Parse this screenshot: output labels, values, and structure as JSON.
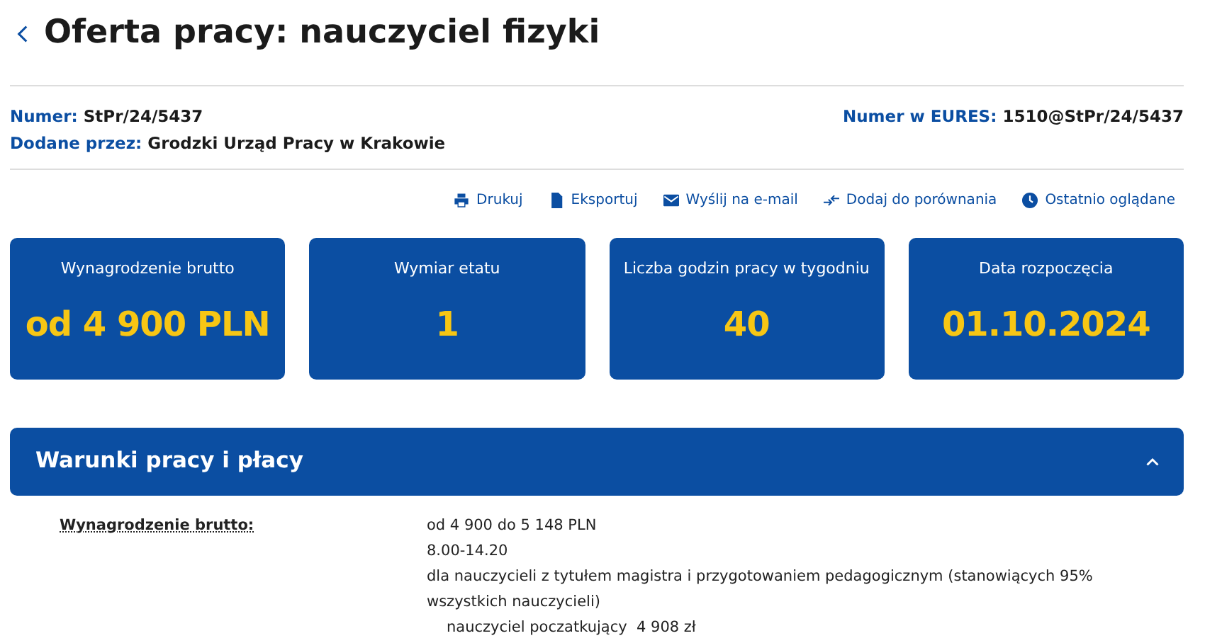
{
  "title": "Oferta pracy: nauczyciel fizyki",
  "meta_left": [
    {
      "label": "Numer:",
      "value": "StPr/24/5437"
    },
    {
      "label": "Dodane przez:",
      "value": "Grodzki Urząd Pracy w Krakowie"
    }
  ],
  "meta_right": [
    {
      "label": "Numer w EURES:",
      "value": "1510@StPr/24/5437"
    }
  ],
  "actions": [
    {
      "kind": "print",
      "label": "Drukuj"
    },
    {
      "kind": "export",
      "label": "Eksportuj"
    },
    {
      "kind": "email",
      "label": "Wyślij na e-mail"
    },
    {
      "kind": "compare",
      "label": "Dodaj do porównania"
    },
    {
      "kind": "recent",
      "label": "Ostatnio oglądane"
    }
  ],
  "tiles": [
    {
      "label": "Wynagrodzenie brutto",
      "value": "od 4 900 PLN"
    },
    {
      "label": "Wymiar etatu",
      "value": "1"
    },
    {
      "label": "Liczba godzin pracy w tygodniu",
      "value": "40"
    },
    {
      "label": "Data rozpoczęcia",
      "value": "01.10.2024"
    }
  ],
  "section": {
    "title": "Warunki pracy i płacy",
    "expanded": true,
    "rows": [
      {
        "label": "Wynagrodzenie brutto:",
        "lines": [
          {
            "kind": "plain",
            "text": "od 4 900 do 5 148 PLN"
          },
          {
            "kind": "plain",
            "text": "8.00-14.20"
          },
          {
            "kind": "plain",
            "text": "dla nauczycieli z tytułem magistra i przygotowaniem pedagogicznym (stanowiących 95% wszystkich nauczycieli)"
          },
          {
            "kind": "indented",
            "text": "nauczyciel poczatkujący  4 908 zł"
          }
        ]
      }
    ]
  }
}
